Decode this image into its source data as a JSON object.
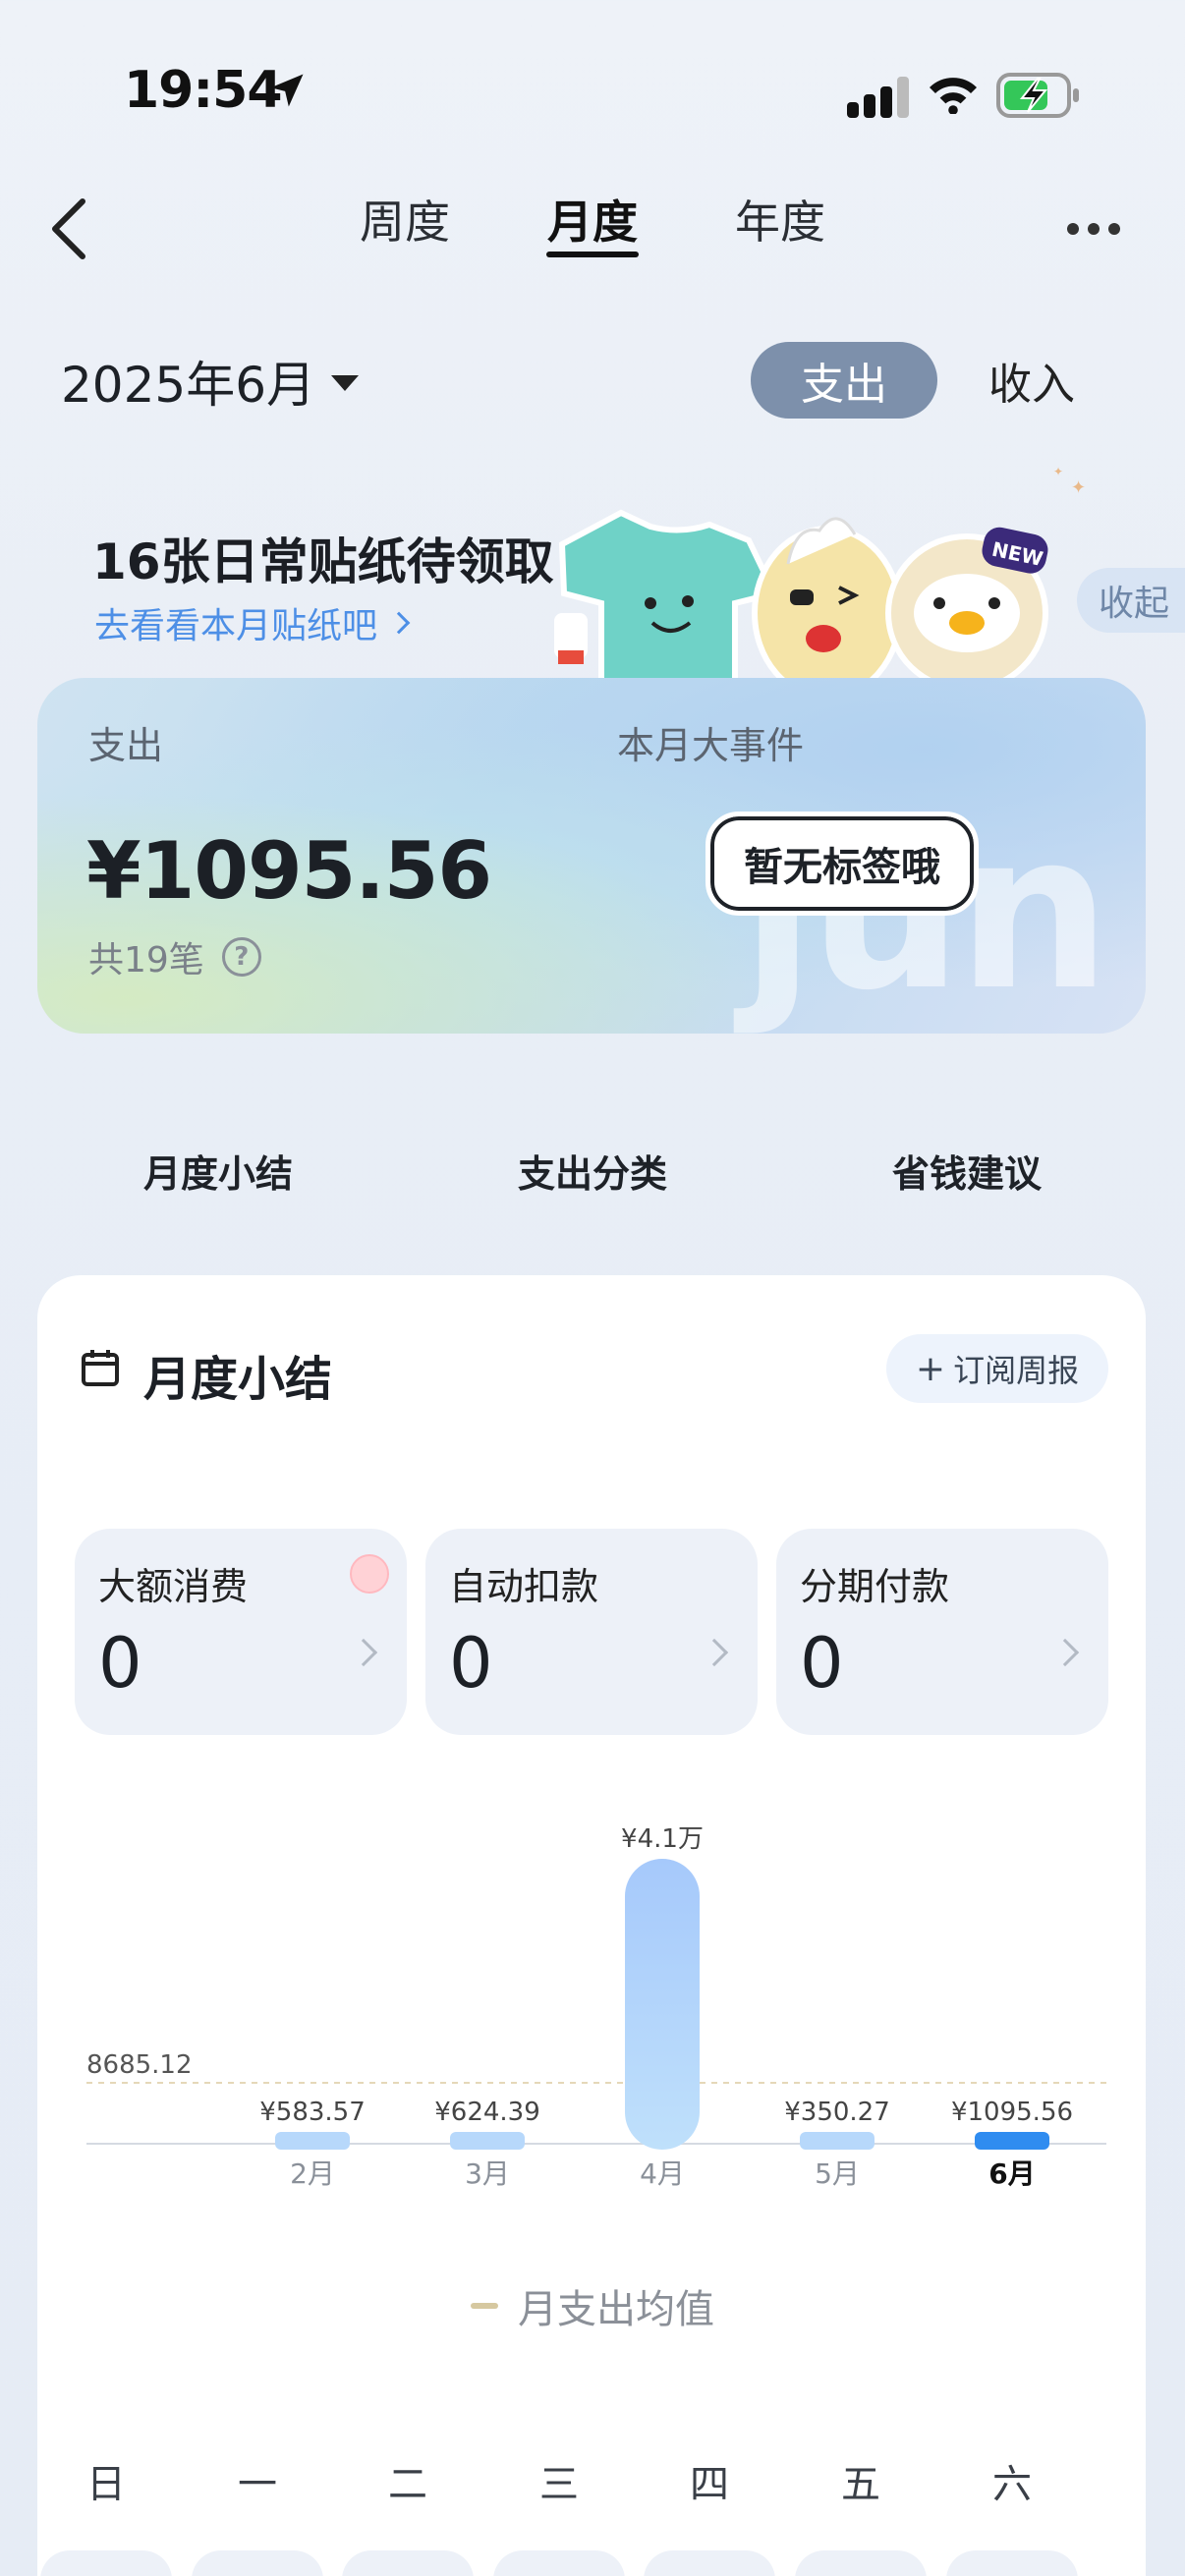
{
  "status_bar": {
    "time": "19:54"
  },
  "nav": {
    "tabs": [
      {
        "label": "周度",
        "active": false
      },
      {
        "label": "月度",
        "active": true
      },
      {
        "label": "年度",
        "active": false
      }
    ]
  },
  "period": {
    "month_label": "2025年6月"
  },
  "type_toggle": {
    "expense": "支出",
    "income": "收入",
    "selected": "expense"
  },
  "banner": {
    "title": "16张日常贴纸待领取",
    "link": "去看看本月贴纸吧",
    "collapse": "收起",
    "new_badge": "NEW"
  },
  "summary": {
    "label": "支出",
    "amount": "¥1095.56",
    "count": "共19笔",
    "events_label": "本月大事件",
    "no_tag": "暂无标签哦",
    "watermark": "jun"
  },
  "section_tabs": [
    "月度小结",
    "支出分类",
    "省钱建议"
  ],
  "monthly_summary": {
    "title": "月度小结",
    "subscribe_label": "订阅周报",
    "stats": [
      {
        "label": "大额消费",
        "value": "0"
      },
      {
        "label": "自动扣款",
        "value": "0"
      },
      {
        "label": "分期付款",
        "value": "0"
      }
    ]
  },
  "chart_data": {
    "type": "bar",
    "categories": [
      "2月",
      "3月",
      "4月",
      "5月",
      "6月"
    ],
    "values": [
      583.57,
      624.39,
      41000,
      350.27,
      1095.56
    ],
    "value_labels": [
      "¥583.57",
      "¥624.39",
      "¥4.1万",
      "¥350.27",
      "¥1095.56"
    ],
    "highlight_category": "6月",
    "average": {
      "value": 8685.12,
      "label": "8685.12"
    },
    "legend": "月支出均值",
    "colors": {
      "bar": "#b7d8fb",
      "bar_top": "#a6c9fb",
      "highlight": "#2f8cf0",
      "average_line": "#e5d8b8"
    }
  },
  "weekdays": [
    "日",
    "一",
    "二",
    "三",
    "四",
    "五",
    "六"
  ]
}
